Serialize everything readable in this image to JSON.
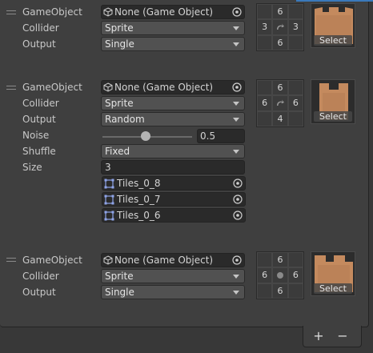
{
  "rules": [
    {
      "game_object": {
        "label": "GameObject",
        "value": "None (Game Object)"
      },
      "collider": {
        "label": "Collider",
        "value": "Sprite"
      },
      "output": {
        "label": "Output",
        "value": "Single"
      },
      "neighbors": [
        "",
        "6",
        "",
        "3",
        "arrow",
        "3",
        "",
        "6",
        ""
      ],
      "sprite_select": "Select"
    },
    {
      "game_object": {
        "label": "GameObject",
        "value": "None (Game Object)"
      },
      "collider": {
        "label": "Collider",
        "value": "Sprite"
      },
      "output": {
        "label": "Output",
        "value": "Random"
      },
      "noise": {
        "label": "Noise",
        "value": "0.5",
        "fraction": 0.5
      },
      "shuffle": {
        "label": "Shuffle",
        "value": "Fixed"
      },
      "size": {
        "label": "Size",
        "value": "3"
      },
      "tiles": [
        "Tiles_0_8",
        "Tiles_0_7",
        "Tiles_0_6"
      ],
      "neighbors": [
        "",
        "6",
        "",
        "6",
        "arrow",
        "6",
        "",
        "4",
        ""
      ],
      "sprite_select": "Select"
    },
    {
      "game_object": {
        "label": "GameObject",
        "value": "None (Game Object)"
      },
      "collider": {
        "label": "Collider",
        "value": "Sprite"
      },
      "output": {
        "label": "Output",
        "value": "Single"
      },
      "neighbors": [
        "",
        "6",
        "",
        "6",
        "dot",
        "6",
        "",
        "6",
        ""
      ],
      "sprite_select": "Select"
    }
  ],
  "footer": {
    "add_label": "+",
    "remove_label": "−"
  },
  "colors": {
    "accent": "#3a79bb",
    "sprite": "#c48a5e"
  }
}
